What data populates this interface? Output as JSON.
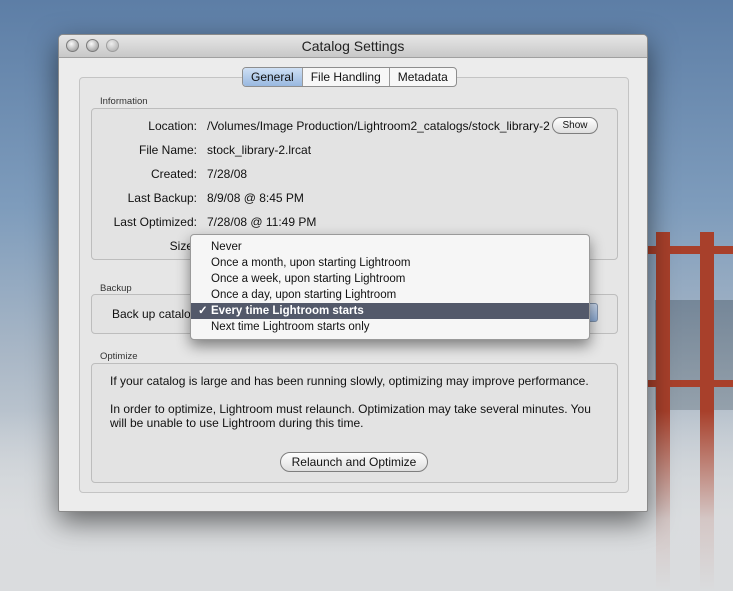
{
  "window": {
    "title": "Catalog Settings"
  },
  "tabs": [
    {
      "label": "General",
      "active": true
    },
    {
      "label": "File Handling",
      "active": false
    },
    {
      "label": "Metadata",
      "active": false
    }
  ],
  "information": {
    "section_label": "Information",
    "location_label": "Location:",
    "location_value": "/Volumes/Image Production/Lightroom2_catalogs/stock_library-2",
    "show_button": "Show",
    "file_name_label": "File Name:",
    "file_name_value": "stock_library-2.lrcat",
    "created_label": "Created:",
    "created_value": "7/28/08",
    "last_backup_label": "Last Backup:",
    "last_backup_value": "8/9/08 @ 8:45 PM",
    "last_optimized_label": "Last Optimized:",
    "last_optimized_value": "7/28/08 @ 11:49 PM",
    "size_label": "Size"
  },
  "backup": {
    "section_label": "Backup",
    "back_up_label": "Back up catalog",
    "menu_options": [
      "Never",
      "Once a month, upon starting Lightroom",
      "Once a week, upon starting Lightroom",
      "Once a day, upon starting Lightroom",
      "Every time Lightroom starts",
      "Next time Lightroom starts only"
    ],
    "selected_index": 4,
    "check_mark": "✓"
  },
  "optimize": {
    "section_label": "Optimize",
    "text_1": "If your catalog is large and has been running slowly, optimizing may improve performance.",
    "text_2_line1": "In order to optimize, Lightroom must relaunch. Optimization may take several minutes. You",
    "text_2_line2": "will be unable to use Lightroom during this time.",
    "button": "Relaunch and Optimize"
  }
}
